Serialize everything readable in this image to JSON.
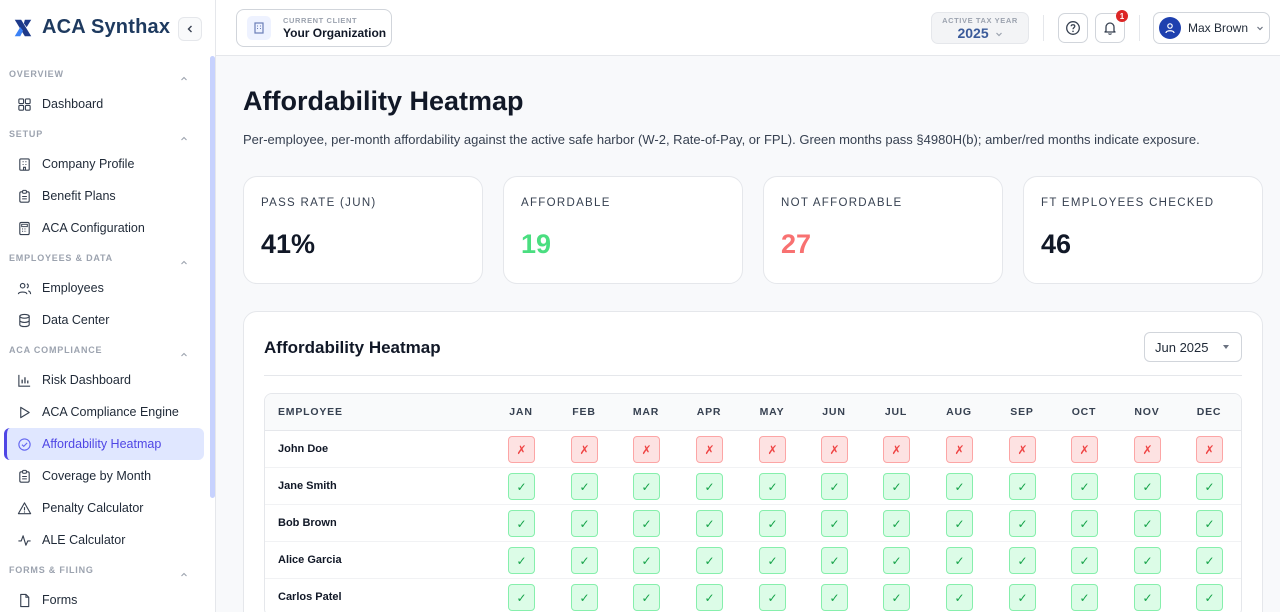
{
  "brand": {
    "name": "ACA Synthax"
  },
  "sidebar": {
    "sections": [
      {
        "label": "Overview",
        "items": [
          {
            "label": "Dashboard",
            "icon": "grid-icon"
          }
        ]
      },
      {
        "label": "Setup",
        "items": [
          {
            "label": "Company Profile",
            "icon": "building-icon"
          },
          {
            "label": "Benefit Plans",
            "icon": "clipboard-icon"
          },
          {
            "label": "ACA Configuration",
            "icon": "calculator-icon"
          }
        ]
      },
      {
        "label": "Employees & Data",
        "items": [
          {
            "label": "Employees",
            "icon": "users-icon"
          },
          {
            "label": "Data Center",
            "icon": "database-icon"
          }
        ]
      },
      {
        "label": "ACA Compliance",
        "items": [
          {
            "label": "Risk Dashboard",
            "icon": "bar-chart-icon"
          },
          {
            "label": "ACA Compliance Engine",
            "icon": "play-icon"
          },
          {
            "label": "Affordability Heatmap",
            "icon": "check-circle-icon",
            "active": true
          },
          {
            "label": "Coverage by Month",
            "icon": "clipboard-icon"
          },
          {
            "label": "Penalty Calculator",
            "icon": "alert-triangle-icon"
          },
          {
            "label": "ALE Calculator",
            "icon": "activity-icon"
          }
        ]
      },
      {
        "label": "Forms & Filing",
        "items": [
          {
            "label": "Forms",
            "icon": "file-icon"
          }
        ]
      }
    ]
  },
  "header": {
    "client_label": "Current Client",
    "client_name": "Your Organization",
    "taxyear_label": "Active Tax Year",
    "taxyear_value": "2025",
    "notifications_count": "1",
    "user_name": "Max Brown"
  },
  "page": {
    "title": "Affordability Heatmap",
    "description": "Per-employee, per-month affordability against the active safe harbor (W-2, Rate-of-Pay, or FPL). Green months pass §4980H(b); amber/red months indicate exposure."
  },
  "stats": [
    {
      "label": "Pass Rate (Jun)",
      "value": "41%",
      "color": "#111827"
    },
    {
      "label": "Affordable",
      "value": "19",
      "color": "#4ade80"
    },
    {
      "label": "Not Affordable",
      "value": "27",
      "color": "#f87171"
    },
    {
      "label": "FT Employees Checked",
      "value": "46",
      "color": "#111827"
    }
  ],
  "heatmap": {
    "title": "Affordability Heatmap",
    "selected_month": "Jun 2025",
    "employee_header": "Employee",
    "months": [
      "Jan",
      "Feb",
      "Mar",
      "Apr",
      "May",
      "Jun",
      "Jul",
      "Aug",
      "Sep",
      "Oct",
      "Nov",
      "Dec"
    ],
    "pass_symbol": "✓",
    "fail_symbol": "✗",
    "rows": [
      {
        "name": "John Doe",
        "status": [
          "fail",
          "fail",
          "fail",
          "fail",
          "fail",
          "fail",
          "fail",
          "fail",
          "fail",
          "fail",
          "fail",
          "fail"
        ]
      },
      {
        "name": "Jane Smith",
        "status": [
          "pass",
          "pass",
          "pass",
          "pass",
          "pass",
          "pass",
          "pass",
          "pass",
          "pass",
          "pass",
          "pass",
          "pass"
        ]
      },
      {
        "name": "Bob Brown",
        "status": [
          "pass",
          "pass",
          "pass",
          "pass",
          "pass",
          "pass",
          "pass",
          "pass",
          "pass",
          "pass",
          "pass",
          "pass"
        ]
      },
      {
        "name": "Alice Garcia",
        "status": [
          "pass",
          "pass",
          "pass",
          "pass",
          "pass",
          "pass",
          "pass",
          "pass",
          "pass",
          "pass",
          "pass",
          "pass"
        ]
      },
      {
        "name": "Carlos Patel",
        "status": [
          "pass",
          "pass",
          "pass",
          "pass",
          "pass",
          "pass",
          "pass",
          "pass",
          "pass",
          "pass",
          "pass",
          "pass"
        ]
      }
    ]
  }
}
